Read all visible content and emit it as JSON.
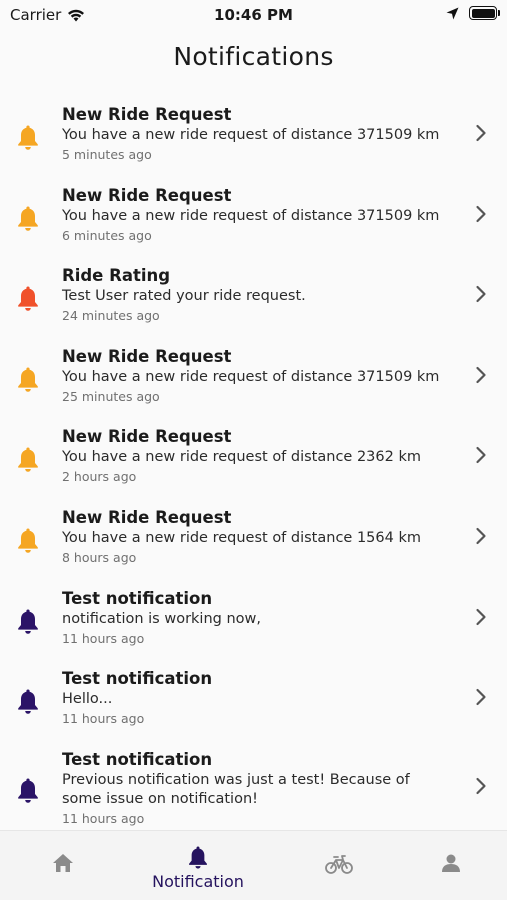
{
  "status": {
    "carrier": "Carrier",
    "time": "10:46 PM"
  },
  "header": {
    "title": "Notifications"
  },
  "colors": {
    "orange": "#f5a623",
    "red": "#f0512b",
    "purple": "#2b1467",
    "chevron": "#555555",
    "tab_inactive": "#8a8a8a"
  },
  "notifications": [
    {
      "title": "New Ride Request",
      "message": "You have a new ride request of distance 371509 km",
      "time": "5 minutes ago",
      "icon": "bell-icon",
      "color": "orange"
    },
    {
      "title": "New Ride Request",
      "message": "You have a new ride request of distance 371509 km",
      "time": "6 minutes ago",
      "icon": "bell-icon",
      "color": "orange"
    },
    {
      "title": "Ride Rating",
      "message": "Test User rated your ride request.",
      "time": "24 minutes ago",
      "icon": "bell-icon",
      "color": "red"
    },
    {
      "title": "New Ride Request",
      "message": "You have a new ride request of distance 371509 km",
      "time": "25 minutes ago",
      "icon": "bell-icon",
      "color": "orange"
    },
    {
      "title": "New Ride Request",
      "message": "You have a new ride request of distance 2362 km",
      "time": "2 hours ago",
      "icon": "bell-icon",
      "color": "orange"
    },
    {
      "title": "New Ride Request",
      "message": "You have a new ride request of distance 1564 km",
      "time": "8 hours ago",
      "icon": "bell-icon",
      "color": "orange"
    },
    {
      "title": "Test notification",
      "message": "notification is working now,",
      "time": "11 hours ago",
      "icon": "bell-icon",
      "color": "purple"
    },
    {
      "title": "Test notification",
      "message": "Hello...",
      "time": "11 hours ago",
      "icon": "bell-icon",
      "color": "purple"
    },
    {
      "title": "Test notification",
      "message": "Previous notification was just a test! Because of some issue on notification!",
      "time": "11 hours ago",
      "icon": "bell-icon",
      "color": "purple"
    }
  ],
  "tabbar": {
    "tabs": [
      {
        "name": "home",
        "icon": "home-icon"
      },
      {
        "name": "notification",
        "icon": "bell-icon",
        "label": "Notification",
        "active": true
      },
      {
        "name": "rides",
        "icon": "bicycle-icon"
      },
      {
        "name": "profile",
        "icon": "person-icon"
      }
    ]
  }
}
